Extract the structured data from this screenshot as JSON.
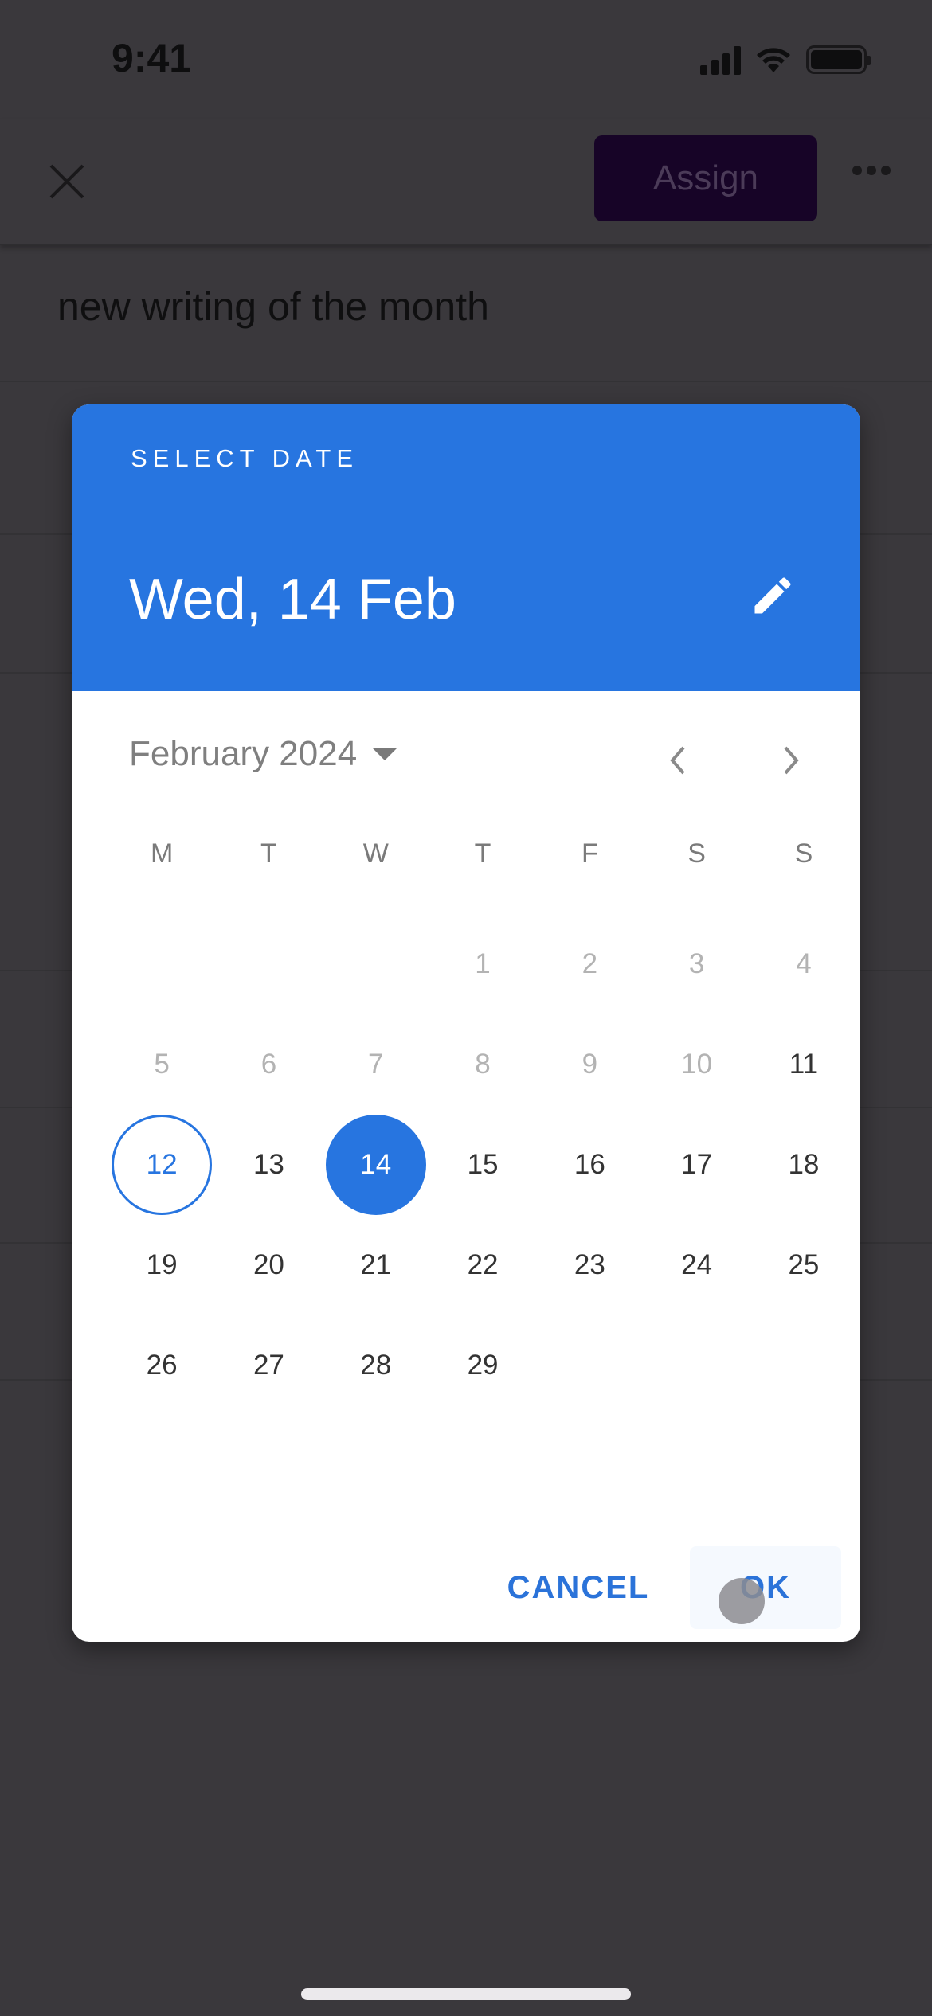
{
  "status_bar": {
    "time": "9:41"
  },
  "toolbar": {
    "assign_label": "Assign",
    "assign_color": "#170427"
  },
  "background": {
    "title_field_value": "new writing of the month"
  },
  "date_picker": {
    "header_label": "SELECT DATE",
    "selected_date_display": "Wed, 14 Feb",
    "month_label": "February 2024",
    "accent_color": "#2775e0",
    "weekdays": [
      "M",
      "T",
      "W",
      "T",
      "F",
      "S",
      "S"
    ],
    "leading_blank_days": 3,
    "days": [
      {
        "n": "1",
        "state": "disabled"
      },
      {
        "n": "2",
        "state": "disabled"
      },
      {
        "n": "3",
        "state": "disabled"
      },
      {
        "n": "4",
        "state": "disabled"
      },
      {
        "n": "5",
        "state": "disabled"
      },
      {
        "n": "6",
        "state": "disabled"
      },
      {
        "n": "7",
        "state": "disabled"
      },
      {
        "n": "8",
        "state": "disabled"
      },
      {
        "n": "9",
        "state": "disabled"
      },
      {
        "n": "10",
        "state": "disabled"
      },
      {
        "n": "11",
        "state": "enabled"
      },
      {
        "n": "12",
        "state": "today"
      },
      {
        "n": "13",
        "state": "enabled"
      },
      {
        "n": "14",
        "state": "selected"
      },
      {
        "n": "15",
        "state": "enabled"
      },
      {
        "n": "16",
        "state": "enabled"
      },
      {
        "n": "17",
        "state": "enabled"
      },
      {
        "n": "18",
        "state": "enabled"
      },
      {
        "n": "19",
        "state": "enabled"
      },
      {
        "n": "20",
        "state": "enabled"
      },
      {
        "n": "21",
        "state": "enabled"
      },
      {
        "n": "22",
        "state": "enabled"
      },
      {
        "n": "23",
        "state": "enabled"
      },
      {
        "n": "24",
        "state": "enabled"
      },
      {
        "n": "25",
        "state": "enabled"
      },
      {
        "n": "26",
        "state": "enabled"
      },
      {
        "n": "27",
        "state": "enabled"
      },
      {
        "n": "28",
        "state": "enabled"
      },
      {
        "n": "29",
        "state": "enabled"
      }
    ],
    "cancel_label": "CANCEL",
    "ok_label": "OK"
  }
}
